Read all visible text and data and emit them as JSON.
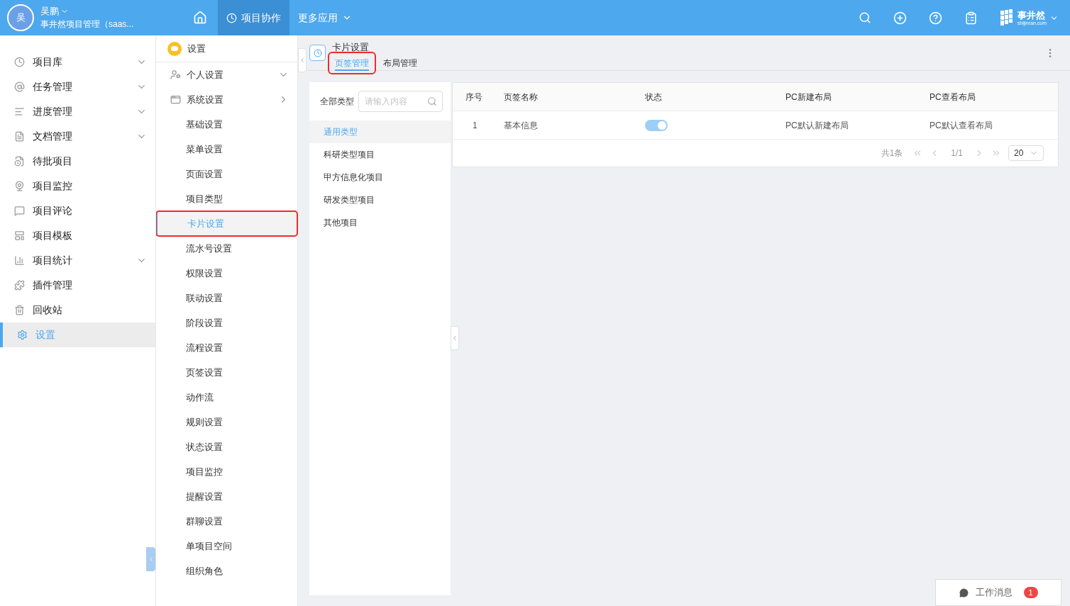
{
  "header": {
    "avatar": "吴",
    "user_name": "吴鹏",
    "org": "事井然项目管理（saas...",
    "nav": [
      {
        "label": "项目协作",
        "selected": true,
        "dropdown": false
      },
      {
        "label": "更多应用",
        "selected": false,
        "dropdown": true
      }
    ],
    "logo_text": "事井然",
    "logo_domain": "shijinran.com"
  },
  "sidebar": {
    "items": [
      {
        "label": "项目库",
        "selected": false,
        "expandable": true
      },
      {
        "label": "任务管理",
        "selected": false,
        "expandable": true
      },
      {
        "label": "进度管理",
        "selected": false,
        "expandable": true
      },
      {
        "label": "文档管理",
        "selected": false,
        "expandable": true
      },
      {
        "label": "待批项目",
        "selected": false,
        "expandable": false
      },
      {
        "label": "项目监控",
        "selected": false,
        "expandable": false
      },
      {
        "label": "项目评论",
        "selected": false,
        "expandable": false
      },
      {
        "label": "项目模板",
        "selected": false,
        "expandable": false
      },
      {
        "label": "项目统计",
        "selected": false,
        "expandable": true
      },
      {
        "label": "插件管理",
        "selected": false,
        "expandable": false
      },
      {
        "label": "回收站",
        "selected": false,
        "expandable": false
      },
      {
        "label": "设置",
        "selected": true,
        "expandable": false
      }
    ]
  },
  "settings_menu": {
    "title": "设置",
    "groups": [
      {
        "label": "个人设置",
        "arrow_down": true
      },
      {
        "label": "系统设置",
        "arrow_down": false,
        "children": [
          {
            "label": "基础设置",
            "selected": false,
            "annotated": false
          },
          {
            "label": "菜单设置",
            "selected": false,
            "annotated": false
          },
          {
            "label": "页面设置",
            "selected": false,
            "annotated": false
          },
          {
            "label": "项目类型",
            "selected": false,
            "annotated": false
          },
          {
            "label": "卡片设置",
            "selected": true,
            "annotated": true
          },
          {
            "label": "流水号设置",
            "selected": false,
            "annotated": false
          },
          {
            "label": "权限设置",
            "selected": false,
            "annotated": false
          },
          {
            "label": "联动设置",
            "selected": false,
            "annotated": false
          },
          {
            "label": "阶段设置",
            "selected": false,
            "annotated": false
          },
          {
            "label": "流程设置",
            "selected": false,
            "annotated": false
          },
          {
            "label": "页签设置",
            "selected": false,
            "annotated": false
          },
          {
            "label": "动作流",
            "selected": false,
            "annotated": false
          },
          {
            "label": "规则设置",
            "selected": false,
            "annotated": false
          },
          {
            "label": "状态设置",
            "selected": false,
            "annotated": false
          },
          {
            "label": "项目监控",
            "selected": false,
            "annotated": false
          },
          {
            "label": "提醒设置",
            "selected": false,
            "annotated": false
          },
          {
            "label": "群聊设置",
            "selected": false,
            "annotated": false
          },
          {
            "label": "单项目空间",
            "selected": false,
            "annotated": false
          },
          {
            "label": "组织角色",
            "selected": false,
            "annotated": false
          }
        ]
      }
    ]
  },
  "page": {
    "title": "卡片设置",
    "tabs": [
      {
        "label": "页签管理",
        "selected": true,
        "annotated": true
      },
      {
        "label": "布局管理",
        "selected": false,
        "annotated": false
      }
    ]
  },
  "types": {
    "label": "全部类型",
    "search": {
      "placeholder": "请输入内容"
    },
    "items": [
      {
        "label": "通用类型",
        "selected": true
      },
      {
        "label": "科研类型项目",
        "selected": false
      },
      {
        "label": "甲方信息化项目",
        "selected": false
      },
      {
        "label": "研发类型项目",
        "selected": false
      },
      {
        "label": "其他项目",
        "selected": false
      }
    ]
  },
  "table": {
    "columns": [
      "序号",
      "页签名称",
      "状态",
      "PC新建布局",
      "PC查看布局"
    ],
    "rows": [
      {
        "index": "1",
        "name": "基本信息",
        "on": true,
        "new_layout": "PC默认新建布局",
        "view_layout": "PC默认查看布局"
      }
    ]
  },
  "pagination": {
    "total": "共1条",
    "page": "1/1",
    "page_size": "20"
  },
  "messages": {
    "label": "工作消息",
    "count": "1"
  }
}
